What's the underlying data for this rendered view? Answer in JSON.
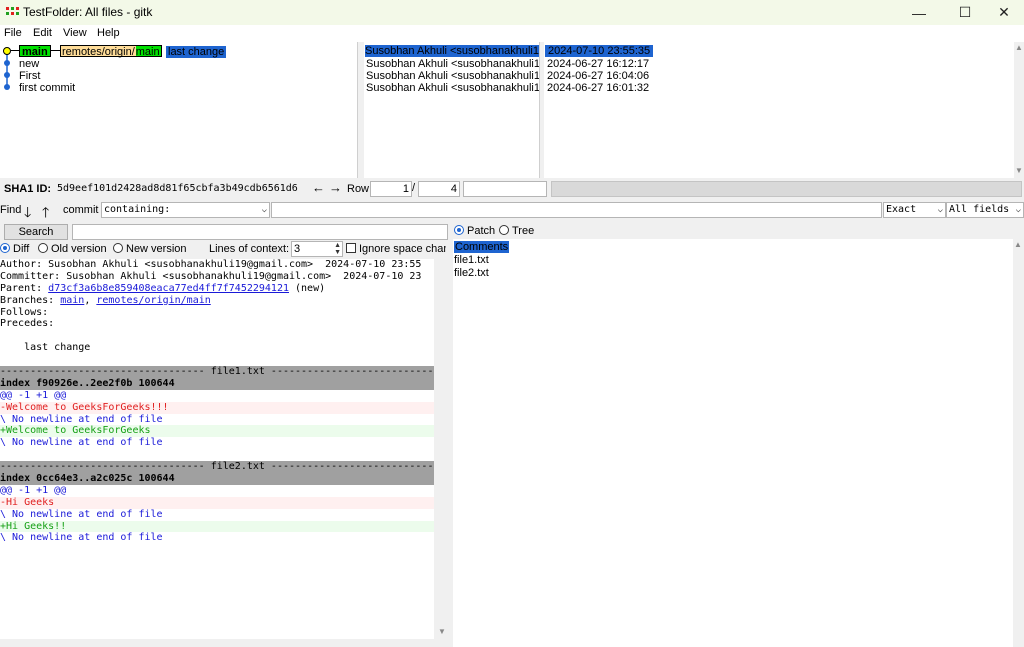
{
  "window": {
    "title": "TestFolder: All files - gitk",
    "controls": {
      "minimize": "—",
      "maximize": "☐",
      "close": "✕"
    }
  },
  "menu": [
    "File",
    "Edit",
    "View",
    "Help"
  ],
  "commits": {
    "graph": {
      "branch_main": "main",
      "branch_remote_prefix": "remotes/origin/",
      "branch_remote_name": "main",
      "colors": {
        "local_branch": "#00e000",
        "remote_branch": "#ffdd99",
        "node": "#1e64d0",
        "head_node": "#ffff00"
      }
    },
    "rows": [
      {
        "message": "last change",
        "author": "Susobhan Akhuli <susobhanakhuli19@",
        "date": "2024-07-10 23:55:35",
        "selected": true
      },
      {
        "message": "new",
        "author": "Susobhan Akhuli <susobhanakhuli19@",
        "date": "2024-06-27 16:12:17",
        "selected": false
      },
      {
        "message": "First",
        "author": "Susobhan Akhuli <susobhanakhuli19@",
        "date": "2024-06-27 16:04:06",
        "selected": false
      },
      {
        "message": "first commit",
        "author": "Susobhan Akhuli <susobhanakhuli19@",
        "date": "2024-06-27 16:01:32",
        "selected": false
      }
    ]
  },
  "sha": {
    "label": "SHA1 ID:",
    "value": "5d9eef101d2428ad8d81f65cbfa3b49cdb6561d6",
    "row_label": "Row",
    "row_current": "1",
    "row_separator": "/",
    "row_total": "4"
  },
  "find": {
    "label": "Find",
    "type_label": "commit",
    "mode": "containing:",
    "match": "Exact",
    "fields": "All fields"
  },
  "search": {
    "button": "Search",
    "diff_options": [
      "Diff",
      "Old version",
      "New version"
    ],
    "context_label": "Lines of context:",
    "context_value": "3",
    "ignore_space": "Ignore space chan"
  },
  "right_panel": {
    "modes": [
      "Patch",
      "Tree"
    ],
    "files": [
      "Comments",
      "file1.txt",
      "file2.txt"
    ]
  },
  "diff": {
    "author": "Author: Susobhan Akhuli <susobhanakhuli19@gmail.com>  2024-07-10 23:55",
    "committer": "Committer: Susobhan Akhuli <susobhanakhuli19@gmail.com>  2024-07-10 23",
    "parent_label": "Parent: ",
    "parent_hash": "d73cf3a6b8e859408eaca77ed4ff7f7452294121",
    "parent_suffix": " (new)",
    "branches_label": "Branches: ",
    "branch_1": "main",
    "branch_sep": ", ",
    "branch_2": "remotes/origin/main",
    "follows": "Follows:",
    "precedes": "Precedes:",
    "message": "    last change",
    "file1": {
      "header": "---------------------------------- file1.txt ----------------------------",
      "index": "index f90926e..2ee2f0b 100644",
      "hunk": "@@ -1 +1 @@",
      "removed": "-Welcome to GeeksForGeeks!!!",
      "nonl1": "\\ No newline at end of file",
      "added": "+Welcome to GeeksForGeeks",
      "nonl2": "\\ No newline at end of file"
    },
    "file2": {
      "header": "---------------------------------- file2.txt ----------------------------",
      "index": "index 0cc64e3..a2c025c 100644",
      "hunk": "@@ -1 +1 @@",
      "removed": "-Hi Geeks",
      "nonl1": "\\ No newline at end of file",
      "added": "+Hi Geeks!!",
      "nonl2": "\\ No newline at end of file"
    }
  }
}
